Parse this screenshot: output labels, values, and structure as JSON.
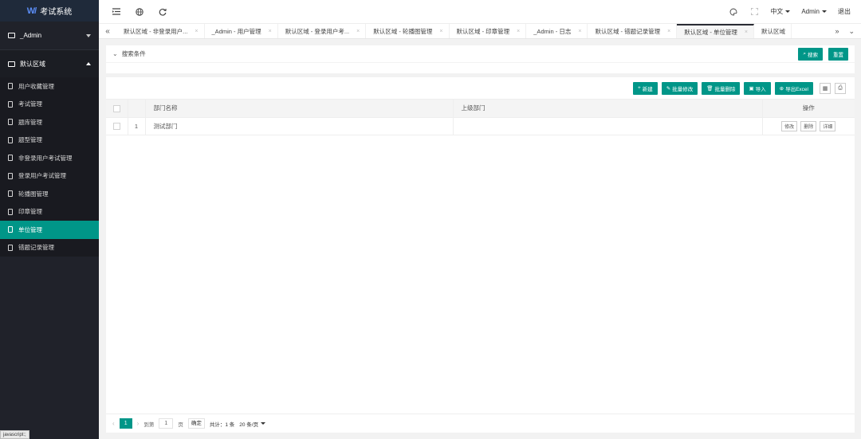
{
  "app": {
    "logo_mark": "W/",
    "title": "考试系统"
  },
  "sidebar": {
    "group1": "_Admin",
    "group2": "默认区域",
    "items": [
      {
        "label": "用户收藏管理"
      },
      {
        "label": "考试管理"
      },
      {
        "label": "题库管理"
      },
      {
        "label": "题型管理"
      },
      {
        "label": "非登录用户考试管理"
      },
      {
        "label": "登录用户考试管理"
      },
      {
        "label": "轮播图管理"
      },
      {
        "label": "印章管理"
      },
      {
        "label": "单位管理"
      },
      {
        "label": "错题记录管理"
      }
    ],
    "status_tip": "javascript:;"
  },
  "header": {
    "language": "中文",
    "user": "Admin",
    "logout": "退出"
  },
  "tabs": [
    {
      "label": "默认区域 - 非登录用户..."
    },
    {
      "label": "_Admin - 用户管理"
    },
    {
      "label": "默认区域 - 登录用户考..."
    },
    {
      "label": "默认区域 - 轮播图管理"
    },
    {
      "label": "默认区域 - 印章管理"
    },
    {
      "label": "_Admin - 日志"
    },
    {
      "label": "默认区域 - 错题记录管理"
    },
    {
      "label": "默认区域 - 单位管理"
    },
    {
      "label": "默认区域"
    }
  ],
  "search": {
    "toggle_label": "搜索条件",
    "search_button": "搜索",
    "reset_button": "重置"
  },
  "toolbar": {
    "new": "新建",
    "batch_edit": "批量修改",
    "batch_delete": "批量删除",
    "import": "导入",
    "export": "导出Excel"
  },
  "table": {
    "columns": [
      "部门名称",
      "上级部门",
      "操作"
    ],
    "rows": [
      {
        "index": "1",
        "name": "测试部门",
        "parent": "",
        "ops": [
          "修改",
          "删除",
          "详细"
        ]
      }
    ]
  },
  "pager": {
    "current": "1",
    "goto_label": "到第",
    "goto_value": "1",
    "page_unit": "页",
    "confirm": "确定",
    "total": "共计：1 条",
    "page_size": "20 条/页"
  },
  "colors": {
    "accent": "#009688",
    "sidebar_bg": "#20222a"
  }
}
